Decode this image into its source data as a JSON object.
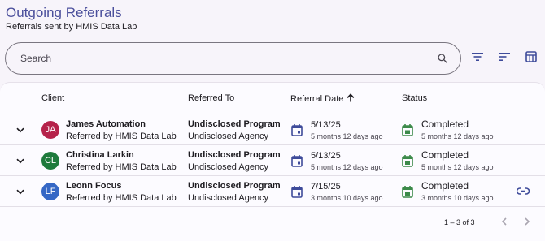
{
  "header": {
    "title": "Outgoing Referrals",
    "subtitle": "Referrals sent by HMIS Data Lab"
  },
  "search": {
    "placeholder": "Search",
    "icon": "search-icon"
  },
  "toolbar": {
    "buttons": [
      "filter-icon",
      "sort-icon",
      "columns-icon"
    ]
  },
  "table": {
    "columns": [
      "Client",
      "Referred To",
      "Referral Date",
      "Status"
    ],
    "sort_column": "Referral Date",
    "sort_direction": "ascending",
    "rows": [
      {
        "initials": "JA",
        "avatar_color": "#b5224a",
        "client": "James Automation",
        "referred_by": "Referred by HMIS Data Lab",
        "program": "Undisclosed Program",
        "agency": "Undisclosed Agency",
        "date": "5/13/25",
        "date_relative": "5 months 12 days ago",
        "status": "Completed",
        "status_relative": "5 months 12 days ago",
        "has_link": false
      },
      {
        "initials": "CL",
        "avatar_color": "#1e7a3c",
        "client": "Christina Larkin",
        "referred_by": "Referred by HMIS Data Lab",
        "program": "Undisclosed Program",
        "agency": "Undisclosed Agency",
        "date": "5/13/25",
        "date_relative": "5 months 12 days ago",
        "status": "Completed",
        "status_relative": "5 months 12 days ago",
        "has_link": false
      },
      {
        "initials": "LF",
        "avatar_color": "#3567c5",
        "client": "Leonn Focus",
        "referred_by": "Referred by HMIS Data Lab",
        "program": "Undisclosed Program",
        "agency": "Undisclosed Agency",
        "date": "7/15/25",
        "date_relative": "3 months 10 days ago",
        "status": "Completed",
        "status_relative": "3 months 10 days ago",
        "has_link": true
      }
    ]
  },
  "pagination": {
    "range": "1 – 3 of 3"
  },
  "colors": {
    "title": "#4b4f9c",
    "calendar_icon": "#3e4b9a",
    "status_icon": "#3c8a4a"
  }
}
